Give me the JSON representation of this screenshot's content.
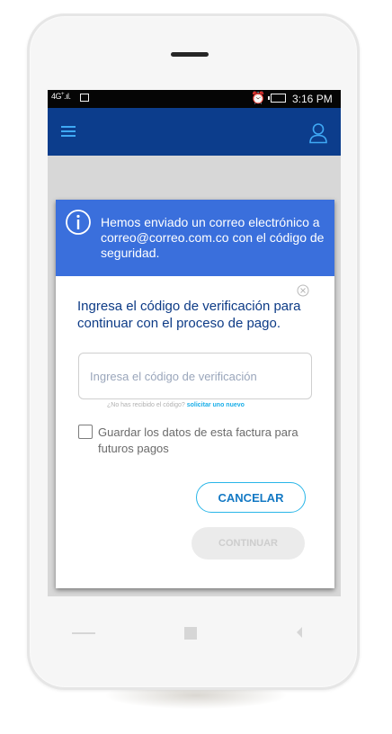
{
  "status_bar": {
    "network": "4G",
    "network_sub": "+",
    "time": "3:16 PM",
    "icons": [
      "signal-icon",
      "image-icon",
      "alarm-icon",
      "battery-icon"
    ]
  },
  "app_bar": {
    "menu_icon": "hamburger-icon",
    "profile_icon": "user-icon",
    "background_color": "#0c3d8c",
    "accent_color": "#3fa9f5"
  },
  "dialog": {
    "header_text": "Hemos enviado un correo electrónico a correo@correo.com.co con el código de seguridad.",
    "header_color": "#3a6fdc",
    "prompt": "Ingresa el código de verificación para continuar con el proceso de pago.",
    "code_input": {
      "placeholder": "Ingresa el código de verificación",
      "value": ""
    },
    "resend_question": "¿No has recibido el código?",
    "resend_link": "solicitar uno nuevo",
    "save_checkbox": {
      "label": "Guardar los datos de esta factura para futuros pagos",
      "checked": false
    },
    "cancel_label": "CANCELAR",
    "continue_label": "CONTINUAR",
    "continue_enabled": false
  }
}
